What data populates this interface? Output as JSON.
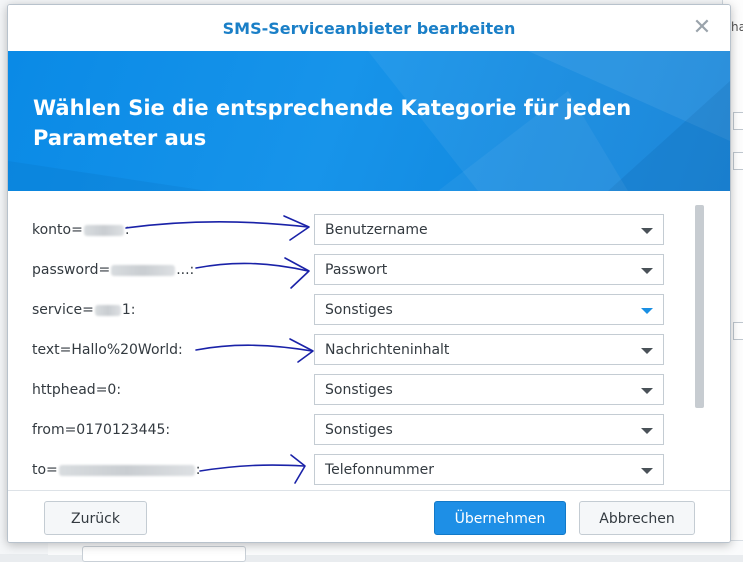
{
  "dialog": {
    "title": "SMS-Serviceanbieter bearbeiten",
    "close_icon": "close-icon",
    "banner_title": "Wählen Sie die entsprechende Kategorie für jeden Parameter aus"
  },
  "background": {
    "right_text": "ha"
  },
  "rows": [
    {
      "label_prefix": "konto=",
      "label_suffix": ":",
      "selected": "Benutzername"
    },
    {
      "label_prefix": "password=",
      "label_suffix": "...:",
      "selected": "Passwort"
    },
    {
      "label_prefix": "service=",
      "label_suffix": "1:",
      "selected": "Sonstiges"
    },
    {
      "label_prefix": "text=Hallo%20World:",
      "label_suffix": "",
      "selected": "Nachrichteninhalt"
    },
    {
      "label_prefix": "httphead=0:",
      "label_suffix": "",
      "selected": "Sonstiges"
    },
    {
      "label_prefix": "from=0170123445:",
      "label_suffix": "",
      "selected": "Sonstiges"
    },
    {
      "label_prefix": "to=",
      "label_suffix": ":",
      "selected": "Telefonnummer"
    }
  ],
  "footer": {
    "back_label": "Zurück",
    "apply_label": "Übernehmen",
    "cancel_label": "Abbrechen"
  },
  "colors": {
    "accent": "#1a7fc7",
    "banner": "#0a8ae6",
    "primary_button": "#1e8fe6",
    "annotation_ink": "#1a22a8"
  }
}
